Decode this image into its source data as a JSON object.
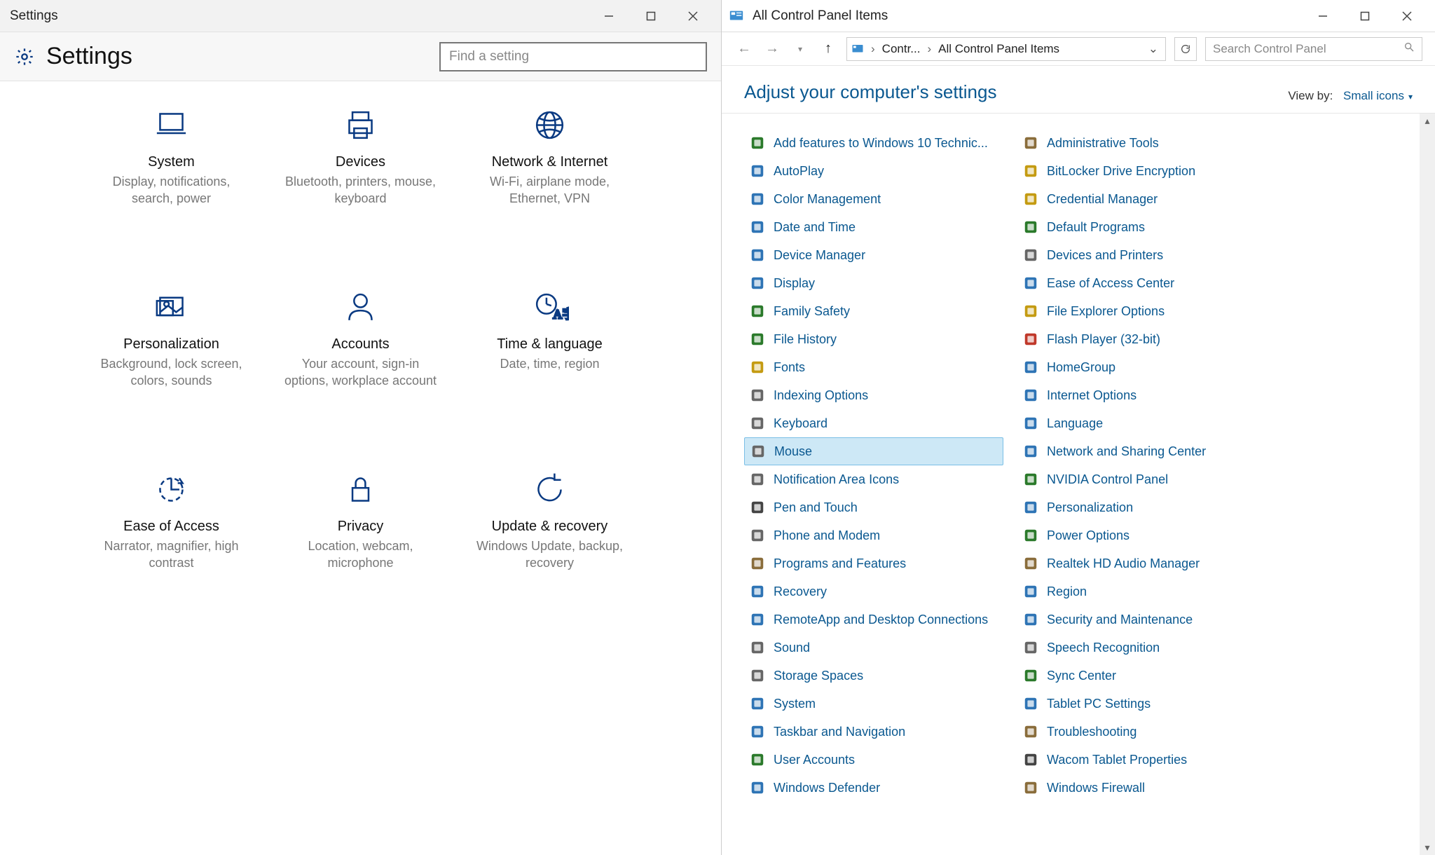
{
  "settings": {
    "window_title": "Settings",
    "header_title": "Settings",
    "search_placeholder": "Find a setting",
    "tiles": [
      {
        "name": "system",
        "label": "System",
        "sub": "Display, notifications, search, power",
        "icon": "laptop"
      },
      {
        "name": "devices",
        "label": "Devices",
        "sub": "Bluetooth, printers, mouse, keyboard",
        "icon": "printer"
      },
      {
        "name": "network",
        "label": "Network & Internet",
        "sub": "Wi-Fi, airplane mode, Ethernet, VPN",
        "icon": "globe"
      },
      {
        "name": "personalization",
        "label": "Personalization",
        "sub": "Background, lock screen, colors, sounds",
        "icon": "picture"
      },
      {
        "name": "accounts",
        "label": "Accounts",
        "sub": "Your account, sign-in options, workplace account",
        "icon": "person"
      },
      {
        "name": "time",
        "label": "Time & language",
        "sub": "Date, time, region",
        "icon": "clock-lang"
      },
      {
        "name": "ease",
        "label": "Ease of Access",
        "sub": "Narrator, magnifier, high contrast",
        "icon": "ease"
      },
      {
        "name": "privacy",
        "label": "Privacy",
        "sub": "Location, webcam, microphone",
        "icon": "lock"
      },
      {
        "name": "update",
        "label": "Update & recovery",
        "sub": "Windows Update, backup, recovery",
        "icon": "sync"
      }
    ]
  },
  "cp": {
    "window_title": "All Control Panel Items",
    "breadcrumb": {
      "root": "Contr...",
      "current": "All Control Panel Items"
    },
    "search_placeholder": "Search Control Panel",
    "heading": "Adjust your computer's settings",
    "viewby_label": "View by:",
    "viewby_value": "Small icons",
    "selected_index": 22,
    "items": [
      {
        "label": "Add features to Windows 10 Technic...",
        "icon": "windows-flag",
        "color": "#2b7a2b"
      },
      {
        "label": "Administrative Tools",
        "icon": "tools",
        "color": "#8a6d3b"
      },
      {
        "label": "AutoPlay",
        "icon": "play",
        "color": "#2e74b5"
      },
      {
        "label": "BitLocker Drive Encryption",
        "icon": "lock",
        "color": "#c49b12"
      },
      {
        "label": "Color Management",
        "icon": "palette",
        "color": "#2e74b5"
      },
      {
        "label": "Credential Manager",
        "icon": "safe",
        "color": "#c49b12"
      },
      {
        "label": "Date and Time",
        "icon": "calendar",
        "color": "#2e74b5"
      },
      {
        "label": "Default Programs",
        "icon": "check",
        "color": "#2b7a2b"
      },
      {
        "label": "Device Manager",
        "icon": "chip",
        "color": "#2e74b5"
      },
      {
        "label": "Devices and Printers",
        "icon": "printer",
        "color": "#666"
      },
      {
        "label": "Display",
        "icon": "monitor",
        "color": "#2e74b5"
      },
      {
        "label": "Ease of Access Center",
        "icon": "ease",
        "color": "#2e74b5"
      },
      {
        "label": "Family Safety",
        "icon": "family",
        "color": "#2b7a2b"
      },
      {
        "label": "File Explorer Options",
        "icon": "folder",
        "color": "#c49b12"
      },
      {
        "label": "File History",
        "icon": "history",
        "color": "#2b7a2b"
      },
      {
        "label": "Flash Player (32-bit)",
        "icon": "flash",
        "color": "#c0392b"
      },
      {
        "label": "Fonts",
        "icon": "fonts",
        "color": "#c49b12"
      },
      {
        "label": "HomeGroup",
        "icon": "homegroup",
        "color": "#2e74b5"
      },
      {
        "label": "Indexing Options",
        "icon": "index",
        "color": "#666"
      },
      {
        "label": "Internet Options",
        "icon": "globe",
        "color": "#2e74b5"
      },
      {
        "label": "Keyboard",
        "icon": "keyboard",
        "color": "#666"
      },
      {
        "label": "Language",
        "icon": "language",
        "color": "#2e74b5"
      },
      {
        "label": "Mouse",
        "icon": "mouse",
        "color": "#666"
      },
      {
        "label": "Network and Sharing Center",
        "icon": "network",
        "color": "#2e74b5"
      },
      {
        "label": "Notification Area Icons",
        "icon": "tray",
        "color": "#666"
      },
      {
        "label": "NVIDIA Control Panel",
        "icon": "nvidia",
        "color": "#2b7a2b"
      },
      {
        "label": "Pen and Touch",
        "icon": "pen",
        "color": "#444"
      },
      {
        "label": "Personalization",
        "icon": "picture",
        "color": "#2e74b5"
      },
      {
        "label": "Phone and Modem",
        "icon": "phone",
        "color": "#666"
      },
      {
        "label": "Power Options",
        "icon": "power",
        "color": "#2b7a2b"
      },
      {
        "label": "Programs and Features",
        "icon": "box",
        "color": "#8a6d3b"
      },
      {
        "label": "Realtek HD Audio Manager",
        "icon": "audio",
        "color": "#8a6d3b"
      },
      {
        "label": "Recovery",
        "icon": "recovery",
        "color": "#2e74b5"
      },
      {
        "label": "Region",
        "icon": "globe",
        "color": "#2e74b5"
      },
      {
        "label": "RemoteApp and Desktop Connections",
        "icon": "remote",
        "color": "#2e74b5"
      },
      {
        "label": "Security and Maintenance",
        "icon": "flag",
        "color": "#2e74b5"
      },
      {
        "label": "Sound",
        "icon": "speaker",
        "color": "#666"
      },
      {
        "label": "Speech Recognition",
        "icon": "mic",
        "color": "#666"
      },
      {
        "label": "Storage Spaces",
        "icon": "drive",
        "color": "#666"
      },
      {
        "label": "Sync Center",
        "icon": "sync",
        "color": "#2b7a2b"
      },
      {
        "label": "System",
        "icon": "system",
        "color": "#2e74b5"
      },
      {
        "label": "Tablet PC Settings",
        "icon": "tablet",
        "color": "#2e74b5"
      },
      {
        "label": "Taskbar and Navigation",
        "icon": "taskbar",
        "color": "#2e74b5"
      },
      {
        "label": "Troubleshooting",
        "icon": "wrench",
        "color": "#8a6d3b"
      },
      {
        "label": "User Accounts",
        "icon": "users",
        "color": "#2b7a2b"
      },
      {
        "label": "Wacom Tablet Properties",
        "icon": "tablet",
        "color": "#444"
      },
      {
        "label": "Windows Defender",
        "icon": "shield",
        "color": "#2e74b5"
      },
      {
        "label": "Windows Firewall",
        "icon": "firewall",
        "color": "#8a6d3b"
      }
    ]
  }
}
